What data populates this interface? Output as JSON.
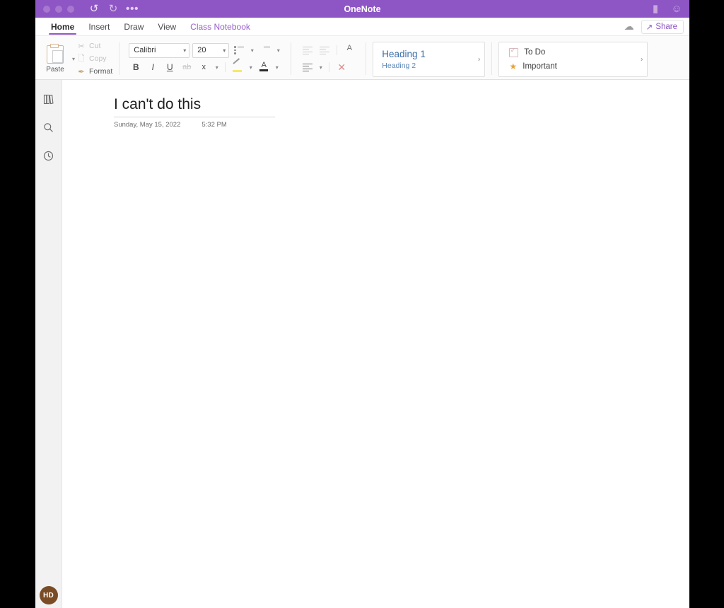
{
  "window": {
    "title": "OneNote",
    "traffic_lights": [
      "close",
      "minimize",
      "maximize"
    ],
    "quick_actions": [
      {
        "name": "undo",
        "glyph": "↺",
        "state": "enabled"
      },
      {
        "name": "redo",
        "glyph": "↻",
        "state": "disabled"
      },
      {
        "name": "more-options",
        "glyph": "•••",
        "state": "enabled"
      }
    ],
    "right_icons": [
      {
        "name": "notification",
        "glyph": "▮"
      },
      {
        "name": "feedback-smiley",
        "glyph": "☺"
      }
    ]
  },
  "ribbon_tabs": [
    {
      "label": "Home",
      "active": true,
      "accent": false
    },
    {
      "label": "Insert",
      "active": false,
      "accent": false
    },
    {
      "label": "Draw",
      "active": false,
      "accent": false
    },
    {
      "label": "View",
      "active": false,
      "accent": false
    },
    {
      "label": "Class Notebook",
      "active": false,
      "accent": true
    }
  ],
  "tabbar_right": {
    "sync_icon": "cloud-sync-icon",
    "share_label": "Share"
  },
  "ribbon": {
    "clipboard": {
      "paste_label": "Paste",
      "cut_label": "Cut",
      "copy_label": "Copy",
      "format_label": "Format"
    },
    "font": {
      "font_name": "Calibri",
      "font_size": "20",
      "bold": "B",
      "italic": "I",
      "underline": "U",
      "strikethrough": "ab",
      "subscript": "x"
    },
    "styles_gallery": {
      "heading1": "Heading 1",
      "heading2": "Heading 2",
      "expand_glyph": "›"
    },
    "tags_gallery": {
      "todo": "To Do",
      "important": "Important",
      "expand_glyph": "›"
    }
  },
  "navrail": {
    "items": [
      {
        "name": "notebooks-icon"
      },
      {
        "name": "search-icon"
      },
      {
        "name": "recent-notes-icon"
      }
    ],
    "avatar_initials": "HD"
  },
  "page": {
    "title": "I can't do this",
    "date": "Sunday, May 15, 2022",
    "time": "5:32 PM"
  },
  "colors": {
    "titlebar_purple": "#8e56c4",
    "accent_purple": "#9a5fc9",
    "avatar_brown": "#7a4c26",
    "tag_star_orange": "#e8a33d",
    "heading_blue": "#3c6fa8"
  }
}
